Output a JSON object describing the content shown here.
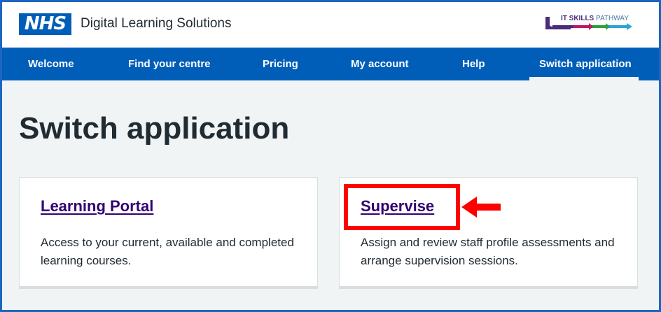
{
  "header": {
    "logo_text": "NHS",
    "service_name": "Digital Learning Solutions",
    "partner_logo": {
      "bold": "IT SKILLS",
      "light": "PATHWAY"
    }
  },
  "nav": {
    "items": [
      {
        "label": "Welcome"
      },
      {
        "label": "Find your centre"
      },
      {
        "label": "Pricing"
      },
      {
        "label": "My account"
      },
      {
        "label": "Help"
      },
      {
        "label": "Switch application",
        "active": true
      }
    ]
  },
  "main": {
    "title": "Switch application",
    "cards": [
      {
        "link": "Learning Portal",
        "description": "Access to your current, available and completed learning courses."
      },
      {
        "link": "Supervise",
        "description": "Assign and review staff profile assessments and arrange supervision sessions.",
        "highlighted": true
      }
    ]
  },
  "colors": {
    "nhs_blue": "#005eb8",
    "link_purple": "#330072",
    "annotation_red": "#ff0000",
    "page_bg": "#f0f4f5"
  }
}
